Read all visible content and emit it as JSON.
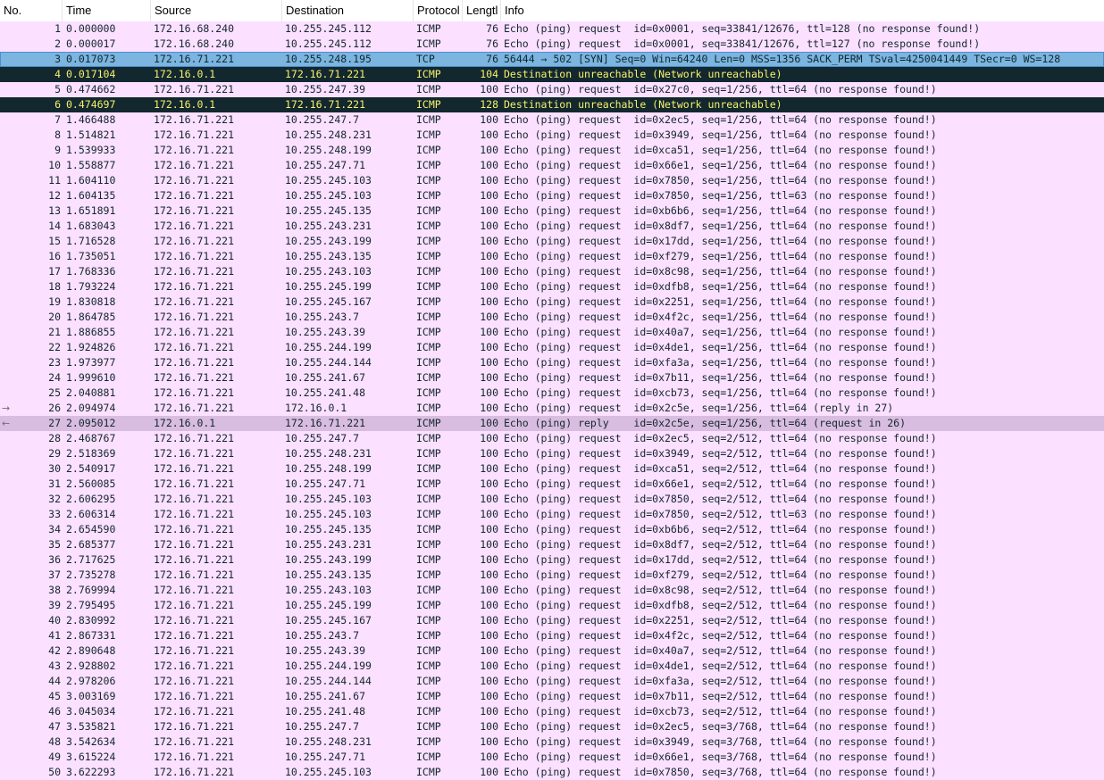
{
  "columns": [
    "No.",
    "Time",
    "Source",
    "Destination",
    "Protocol",
    "Lengtl",
    "Info"
  ],
  "colors": {
    "icmp_bg": "#fce0ff",
    "icmp_fg": "#12272e",
    "selected_bg": "#7bb5e0",
    "selected_fg": "#12272e",
    "error_bg": "#12272e",
    "error_fg": "#f7f16d",
    "reply_bg": "#d9bde0",
    "reply_fg": "#12272e"
  },
  "markers": {
    "request": "→",
    "reply": "←"
  },
  "rows": [
    {
      "no": "1",
      "time": "0.000000",
      "src": "172.16.68.240",
      "dst": "10.255.245.112",
      "proto": "ICMP",
      "len": "76",
      "info": "Echo (ping) request  id=0x0001, seq=33841/12676, ttl=128 (no response found!)",
      "style": "icmp"
    },
    {
      "no": "2",
      "time": "0.000017",
      "src": "172.16.68.240",
      "dst": "10.255.245.112",
      "proto": "ICMP",
      "len": "76",
      "info": "Echo (ping) request  id=0x0001, seq=33841/12676, ttl=127 (no response found!)",
      "style": "icmp"
    },
    {
      "no": "3",
      "time": "0.017073",
      "src": "172.16.71.221",
      "dst": "10.255.248.195",
      "proto": "TCP",
      "len": "76",
      "info": "56444 → 502 [SYN] Seq=0 Win=64240 Len=0 MSS=1356 SACK_PERM TSval=4250041449 TSecr=0 WS=128",
      "style": "selected"
    },
    {
      "no": "4",
      "time": "0.017104",
      "src": "172.16.0.1",
      "dst": "172.16.71.221",
      "proto": "ICMP",
      "len": "104",
      "info": "Destination unreachable (Network unreachable)",
      "style": "error"
    },
    {
      "no": "5",
      "time": "0.474662",
      "src": "172.16.71.221",
      "dst": "10.255.247.39",
      "proto": "ICMP",
      "len": "100",
      "info": "Echo (ping) request  id=0x27c0, seq=1/256, ttl=64 (no response found!)",
      "style": "icmp"
    },
    {
      "no": "6",
      "time": "0.474697",
      "src": "172.16.0.1",
      "dst": "172.16.71.221",
      "proto": "ICMP",
      "len": "128",
      "info": "Destination unreachable (Network unreachable)",
      "style": "error"
    },
    {
      "no": "7",
      "time": "1.466488",
      "src": "172.16.71.221",
      "dst": "10.255.247.7",
      "proto": "ICMP",
      "len": "100",
      "info": "Echo (ping) request  id=0x2ec5, seq=1/256, ttl=64 (no response found!)",
      "style": "icmp"
    },
    {
      "no": "8",
      "time": "1.514821",
      "src": "172.16.71.221",
      "dst": "10.255.248.231",
      "proto": "ICMP",
      "len": "100",
      "info": "Echo (ping) request  id=0x3949, seq=1/256, ttl=64 (no response found!)",
      "style": "icmp"
    },
    {
      "no": "9",
      "time": "1.539933",
      "src": "172.16.71.221",
      "dst": "10.255.248.199",
      "proto": "ICMP",
      "len": "100",
      "info": "Echo (ping) request  id=0xca51, seq=1/256, ttl=64 (no response found!)",
      "style": "icmp"
    },
    {
      "no": "10",
      "time": "1.558877",
      "src": "172.16.71.221",
      "dst": "10.255.247.71",
      "proto": "ICMP",
      "len": "100",
      "info": "Echo (ping) request  id=0x66e1, seq=1/256, ttl=64 (no response found!)",
      "style": "icmp"
    },
    {
      "no": "11",
      "time": "1.604110",
      "src": "172.16.71.221",
      "dst": "10.255.245.103",
      "proto": "ICMP",
      "len": "100",
      "info": "Echo (ping) request  id=0x7850, seq=1/256, ttl=64 (no response found!)",
      "style": "icmp"
    },
    {
      "no": "12",
      "time": "1.604135",
      "src": "172.16.71.221",
      "dst": "10.255.245.103",
      "proto": "ICMP",
      "len": "100",
      "info": "Echo (ping) request  id=0x7850, seq=1/256, ttl=63 (no response found!)",
      "style": "icmp"
    },
    {
      "no": "13",
      "time": "1.651891",
      "src": "172.16.71.221",
      "dst": "10.255.245.135",
      "proto": "ICMP",
      "len": "100",
      "info": "Echo (ping) request  id=0xb6b6, seq=1/256, ttl=64 (no response found!)",
      "style": "icmp"
    },
    {
      "no": "14",
      "time": "1.683043",
      "src": "172.16.71.221",
      "dst": "10.255.243.231",
      "proto": "ICMP",
      "len": "100",
      "info": "Echo (ping) request  id=0x8df7, seq=1/256, ttl=64 (no response found!)",
      "style": "icmp"
    },
    {
      "no": "15",
      "time": "1.716528",
      "src": "172.16.71.221",
      "dst": "10.255.243.199",
      "proto": "ICMP",
      "len": "100",
      "info": "Echo (ping) request  id=0x17dd, seq=1/256, ttl=64 (no response found!)",
      "style": "icmp"
    },
    {
      "no": "16",
      "time": "1.735051",
      "src": "172.16.71.221",
      "dst": "10.255.243.135",
      "proto": "ICMP",
      "len": "100",
      "info": "Echo (ping) request  id=0xf279, seq=1/256, ttl=64 (no response found!)",
      "style": "icmp"
    },
    {
      "no": "17",
      "time": "1.768336",
      "src": "172.16.71.221",
      "dst": "10.255.243.103",
      "proto": "ICMP",
      "len": "100",
      "info": "Echo (ping) request  id=0x8c98, seq=1/256, ttl=64 (no response found!)",
      "style": "icmp"
    },
    {
      "no": "18",
      "time": "1.793224",
      "src": "172.16.71.221",
      "dst": "10.255.245.199",
      "proto": "ICMP",
      "len": "100",
      "info": "Echo (ping) request  id=0xdfb8, seq=1/256, ttl=64 (no response found!)",
      "style": "icmp"
    },
    {
      "no": "19",
      "time": "1.830818",
      "src": "172.16.71.221",
      "dst": "10.255.245.167",
      "proto": "ICMP",
      "len": "100",
      "info": "Echo (ping) request  id=0x2251, seq=1/256, ttl=64 (no response found!)",
      "style": "icmp"
    },
    {
      "no": "20",
      "time": "1.864785",
      "src": "172.16.71.221",
      "dst": "10.255.243.7",
      "proto": "ICMP",
      "len": "100",
      "info": "Echo (ping) request  id=0x4f2c, seq=1/256, ttl=64 (no response found!)",
      "style": "icmp"
    },
    {
      "no": "21",
      "time": "1.886855",
      "src": "172.16.71.221",
      "dst": "10.255.243.39",
      "proto": "ICMP",
      "len": "100",
      "info": "Echo (ping) request  id=0x40a7, seq=1/256, ttl=64 (no response found!)",
      "style": "icmp"
    },
    {
      "no": "22",
      "time": "1.924826",
      "src": "172.16.71.221",
      "dst": "10.255.244.199",
      "proto": "ICMP",
      "len": "100",
      "info": "Echo (ping) request  id=0x4de1, seq=1/256, ttl=64 (no response found!)",
      "style": "icmp"
    },
    {
      "no": "23",
      "time": "1.973977",
      "src": "172.16.71.221",
      "dst": "10.255.244.144",
      "proto": "ICMP",
      "len": "100",
      "info": "Echo (ping) request  id=0xfa3a, seq=1/256, ttl=64 (no response found!)",
      "style": "icmp"
    },
    {
      "no": "24",
      "time": "1.999610",
      "src": "172.16.71.221",
      "dst": "10.255.241.67",
      "proto": "ICMP",
      "len": "100",
      "info": "Echo (ping) request  id=0x7b11, seq=1/256, ttl=64 (no response found!)",
      "style": "icmp"
    },
    {
      "no": "25",
      "time": "2.040881",
      "src": "172.16.71.221",
      "dst": "10.255.241.48",
      "proto": "ICMP",
      "len": "100",
      "info": "Echo (ping) request  id=0xcb73, seq=1/256, ttl=64 (no response found!)",
      "style": "icmp"
    },
    {
      "no": "26",
      "time": "2.094974",
      "src": "172.16.71.221",
      "dst": "172.16.0.1",
      "proto": "ICMP",
      "len": "100",
      "info": "Echo (ping) request  id=0x2c5e, seq=1/256, ttl=64 (reply in 27)",
      "style": "icmp",
      "marker": "request"
    },
    {
      "no": "27",
      "time": "2.095012",
      "src": "172.16.0.1",
      "dst": "172.16.71.221",
      "proto": "ICMP",
      "len": "100",
      "info": "Echo (ping) reply    id=0x2c5e, seq=1/256, ttl=64 (request in 26)",
      "style": "reply",
      "marker": "reply"
    },
    {
      "no": "28",
      "time": "2.468767",
      "src": "172.16.71.221",
      "dst": "10.255.247.7",
      "proto": "ICMP",
      "len": "100",
      "info": "Echo (ping) request  id=0x2ec5, seq=2/512, ttl=64 (no response found!)",
      "style": "icmp"
    },
    {
      "no": "29",
      "time": "2.518369",
      "src": "172.16.71.221",
      "dst": "10.255.248.231",
      "proto": "ICMP",
      "len": "100",
      "info": "Echo (ping) request  id=0x3949, seq=2/512, ttl=64 (no response found!)",
      "style": "icmp"
    },
    {
      "no": "30",
      "time": "2.540917",
      "src": "172.16.71.221",
      "dst": "10.255.248.199",
      "proto": "ICMP",
      "len": "100",
      "info": "Echo (ping) request  id=0xca51, seq=2/512, ttl=64 (no response found!)",
      "style": "icmp"
    },
    {
      "no": "31",
      "time": "2.560085",
      "src": "172.16.71.221",
      "dst": "10.255.247.71",
      "proto": "ICMP",
      "len": "100",
      "info": "Echo (ping) request  id=0x66e1, seq=2/512, ttl=64 (no response found!)",
      "style": "icmp"
    },
    {
      "no": "32",
      "time": "2.606295",
      "src": "172.16.71.221",
      "dst": "10.255.245.103",
      "proto": "ICMP",
      "len": "100",
      "info": "Echo (ping) request  id=0x7850, seq=2/512, ttl=64 (no response found!)",
      "style": "icmp"
    },
    {
      "no": "33",
      "time": "2.606314",
      "src": "172.16.71.221",
      "dst": "10.255.245.103",
      "proto": "ICMP",
      "len": "100",
      "info": "Echo (ping) request  id=0x7850, seq=2/512, ttl=63 (no response found!)",
      "style": "icmp"
    },
    {
      "no": "34",
      "time": "2.654590",
      "src": "172.16.71.221",
      "dst": "10.255.245.135",
      "proto": "ICMP",
      "len": "100",
      "info": "Echo (ping) request  id=0xb6b6, seq=2/512, ttl=64 (no response found!)",
      "style": "icmp"
    },
    {
      "no": "35",
      "time": "2.685377",
      "src": "172.16.71.221",
      "dst": "10.255.243.231",
      "proto": "ICMP",
      "len": "100",
      "info": "Echo (ping) request  id=0x8df7, seq=2/512, ttl=64 (no response found!)",
      "style": "icmp"
    },
    {
      "no": "36",
      "time": "2.717625",
      "src": "172.16.71.221",
      "dst": "10.255.243.199",
      "proto": "ICMP",
      "len": "100",
      "info": "Echo (ping) request  id=0x17dd, seq=2/512, ttl=64 (no response found!)",
      "style": "icmp"
    },
    {
      "no": "37",
      "time": "2.735278",
      "src": "172.16.71.221",
      "dst": "10.255.243.135",
      "proto": "ICMP",
      "len": "100",
      "info": "Echo (ping) request  id=0xf279, seq=2/512, ttl=64 (no response found!)",
      "style": "icmp"
    },
    {
      "no": "38",
      "time": "2.769994",
      "src": "172.16.71.221",
      "dst": "10.255.243.103",
      "proto": "ICMP",
      "len": "100",
      "info": "Echo (ping) request  id=0x8c98, seq=2/512, ttl=64 (no response found!)",
      "style": "icmp"
    },
    {
      "no": "39",
      "time": "2.795495",
      "src": "172.16.71.221",
      "dst": "10.255.245.199",
      "proto": "ICMP",
      "len": "100",
      "info": "Echo (ping) request  id=0xdfb8, seq=2/512, ttl=64 (no response found!)",
      "style": "icmp"
    },
    {
      "no": "40",
      "time": "2.830992",
      "src": "172.16.71.221",
      "dst": "10.255.245.167",
      "proto": "ICMP",
      "len": "100",
      "info": "Echo (ping) request  id=0x2251, seq=2/512, ttl=64 (no response found!)",
      "style": "icmp"
    },
    {
      "no": "41",
      "time": "2.867331",
      "src": "172.16.71.221",
      "dst": "10.255.243.7",
      "proto": "ICMP",
      "len": "100",
      "info": "Echo (ping) request  id=0x4f2c, seq=2/512, ttl=64 (no response found!)",
      "style": "icmp"
    },
    {
      "no": "42",
      "time": "2.890648",
      "src": "172.16.71.221",
      "dst": "10.255.243.39",
      "proto": "ICMP",
      "len": "100",
      "info": "Echo (ping) request  id=0x40a7, seq=2/512, ttl=64 (no response found!)",
      "style": "icmp"
    },
    {
      "no": "43",
      "time": "2.928802",
      "src": "172.16.71.221",
      "dst": "10.255.244.199",
      "proto": "ICMP",
      "len": "100",
      "info": "Echo (ping) request  id=0x4de1, seq=2/512, ttl=64 (no response found!)",
      "style": "icmp"
    },
    {
      "no": "44",
      "time": "2.978206",
      "src": "172.16.71.221",
      "dst": "10.255.244.144",
      "proto": "ICMP",
      "len": "100",
      "info": "Echo (ping) request  id=0xfa3a, seq=2/512, ttl=64 (no response found!)",
      "style": "icmp"
    },
    {
      "no": "45",
      "time": "3.003169",
      "src": "172.16.71.221",
      "dst": "10.255.241.67",
      "proto": "ICMP",
      "len": "100",
      "info": "Echo (ping) request  id=0x7b11, seq=2/512, ttl=64 (no response found!)",
      "style": "icmp"
    },
    {
      "no": "46",
      "time": "3.045034",
      "src": "172.16.71.221",
      "dst": "10.255.241.48",
      "proto": "ICMP",
      "len": "100",
      "info": "Echo (ping) request  id=0xcb73, seq=2/512, ttl=64 (no response found!)",
      "style": "icmp"
    },
    {
      "no": "47",
      "time": "3.535821",
      "src": "172.16.71.221",
      "dst": "10.255.247.7",
      "proto": "ICMP",
      "len": "100",
      "info": "Echo (ping) request  id=0x2ec5, seq=3/768, ttl=64 (no response found!)",
      "style": "icmp"
    },
    {
      "no": "48",
      "time": "3.542634",
      "src": "172.16.71.221",
      "dst": "10.255.248.231",
      "proto": "ICMP",
      "len": "100",
      "info": "Echo (ping) request  id=0x3949, seq=3/768, ttl=64 (no response found!)",
      "style": "icmp"
    },
    {
      "no": "49",
      "time": "3.615224",
      "src": "172.16.71.221",
      "dst": "10.255.247.71",
      "proto": "ICMP",
      "len": "100",
      "info": "Echo (ping) request  id=0x66e1, seq=3/768, ttl=64 (no response found!)",
      "style": "icmp"
    },
    {
      "no": "50",
      "time": "3.622293",
      "src": "172.16.71.221",
      "dst": "10.255.245.103",
      "proto": "ICMP",
      "len": "100",
      "info": "Echo (ping) request  id=0x7850, seq=3/768, ttl=64 (no response found!)",
      "style": "icmp"
    }
  ]
}
